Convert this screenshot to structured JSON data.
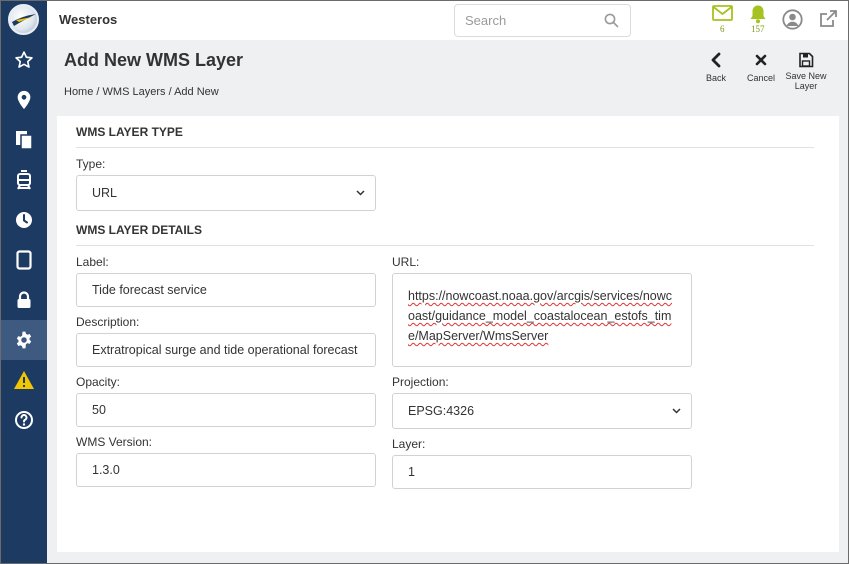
{
  "app": {
    "title": "Westeros"
  },
  "search": {
    "placeholder": "Search"
  },
  "notifications": {
    "mail_count": "6",
    "bell_count": "157"
  },
  "sidebar": {
    "items": [
      {
        "name": "star-icon"
      },
      {
        "name": "map-pin-icon"
      },
      {
        "name": "documents-icon"
      },
      {
        "name": "tram-icon"
      },
      {
        "name": "clock-icon"
      },
      {
        "name": "tablet-icon"
      },
      {
        "name": "lock-icon"
      },
      {
        "name": "gear-icon",
        "active": true
      },
      {
        "name": "warning-icon"
      },
      {
        "name": "help-icon"
      }
    ]
  },
  "page": {
    "title": "Add New WMS Layer",
    "breadcrumb": [
      "Home",
      "WMS Layers",
      "Add New"
    ],
    "breadcrumb_sep": "/"
  },
  "actions": {
    "back": "Back",
    "cancel": "Cancel",
    "save": "Save New Layer"
  },
  "form": {
    "type_section": "WMS LAYER TYPE",
    "type_label": "Type:",
    "type_value": "URL",
    "details_section": "WMS LAYER DETAILS",
    "label_label": "Label:",
    "label_value": "Tide forecast service",
    "description_label": "Description:",
    "description_value": "Extratropical surge and tide operational forecast",
    "opacity_label": "Opacity:",
    "opacity_value": "50",
    "version_label": "WMS Version:",
    "version_value": "1.3.0",
    "url_label": "URL:",
    "url_value": "https://nowcoast.noaa.gov/arcgis/services/nowcoast/guidance_model_coastalocean_estofs_time/MapServer/WmsServer",
    "projection_label": "Projection:",
    "projection_value": "EPSG:4326",
    "layer_label": "Layer:",
    "layer_value": "1"
  },
  "colors": {
    "sidebar": "#1c3a62",
    "sidebar_active": "#3e5a80",
    "notify": "#a6c21f",
    "warning": "#f2c500"
  }
}
